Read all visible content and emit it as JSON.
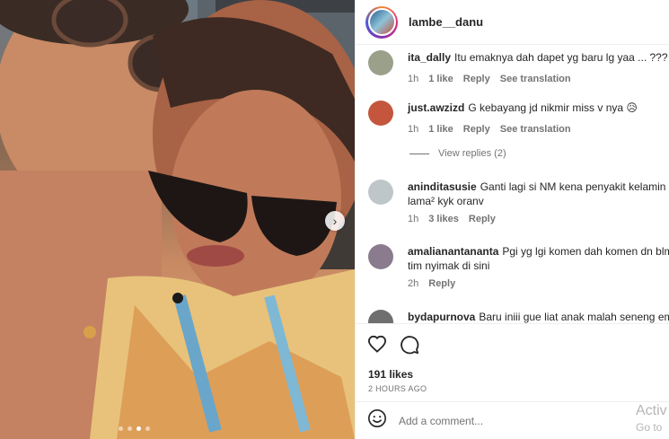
{
  "post": {
    "image_alt": "selfie of a man and a woman in sunglasses",
    "carousel_dots": 4,
    "carousel_active": 2
  },
  "header": {
    "username": "lambe__danu"
  },
  "comments": [
    {
      "user": "ita_dally",
      "text": "Itu emaknya dah dapet yg baru lg yaa ... ??? 😢",
      "time": "1h",
      "likes": "1 like",
      "action": "Reply",
      "translate": "See translation",
      "avatar_color": "#9aa08a"
    },
    {
      "user": "just.awzizd",
      "text": "G kebayang jd nikmir miss v nya 😥",
      "time": "1h",
      "likes": "1 like",
      "action": "Reply",
      "translate": "See translation",
      "avatar_color": "#c4563e"
    },
    {
      "user": "aninditasusie",
      "text": "Ganti lagi si NM kena penyakit kelamin lama² kyk oranv",
      "time": "1h",
      "likes": "3 likes",
      "action": "Reply",
      "avatar_color": "#bfc6c9"
    },
    {
      "user": "amalianantananta",
      "text": "Pgi yg lgi komen dah komen dn blm tim nyimak di sini",
      "time": "2h",
      "action": "Reply",
      "avatar_color": "#8a7b8e"
    },
    {
      "user": "bydapurnova",
      "text": "Baru iniii gue liat anak malah seneng emaknya",
      "avatar_color": "#6f6f6f"
    }
  ],
  "view_replies": "View replies (2)",
  "actions": {
    "heart_icon": "heart-icon",
    "comment_icon": "comment-icon",
    "likes": "191 likes",
    "time": "2 HOURS AGO"
  },
  "add_comment": {
    "placeholder": "Add a comment...",
    "emoji_icon": "emoji-icon"
  },
  "watermark": {
    "line1": "Activ",
    "line2": "Go to"
  }
}
